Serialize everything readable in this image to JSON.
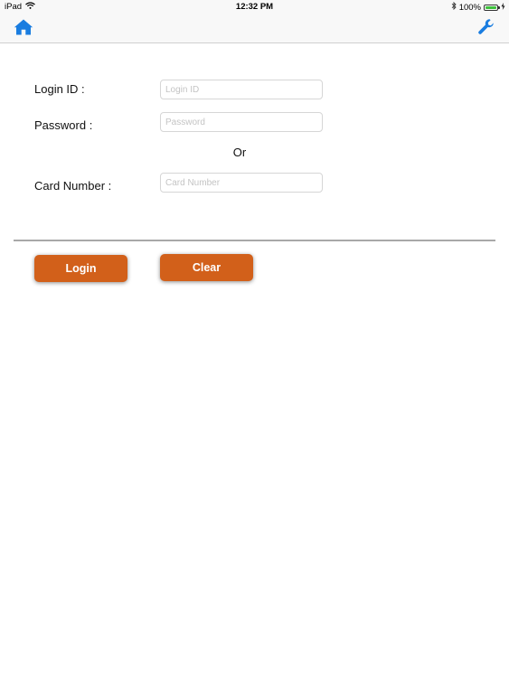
{
  "status_bar": {
    "device": "iPad",
    "time": "12:32 PM",
    "battery_percent": "100%",
    "battery_level": 1.0,
    "battery_color": "#3dc13c"
  },
  "nav_bar": {
    "left_icon": "home-icon",
    "right_icon": "wrench-icon",
    "icon_color": "#1a7de0"
  },
  "form": {
    "login_id": {
      "label": "Login ID :",
      "placeholder": "Login ID",
      "value": ""
    },
    "password": {
      "label": "Password :",
      "placeholder": "Password",
      "value": ""
    },
    "separator": "Or",
    "card_number": {
      "label": "Card Number :",
      "placeholder": "Card Number",
      "value": ""
    }
  },
  "actions": {
    "login_label": "Login",
    "clear_label": "Clear",
    "button_color": "#d2601a"
  }
}
